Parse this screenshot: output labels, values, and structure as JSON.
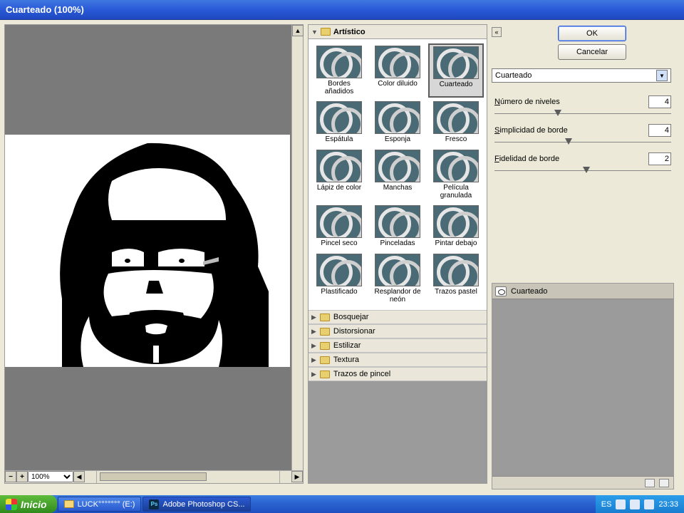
{
  "window": {
    "title": "Cuarteado (100%)"
  },
  "preview": {
    "zoom": "100%"
  },
  "gallery": {
    "open_category": "Artístico",
    "filters": [
      {
        "label": "Bordes añadidos"
      },
      {
        "label": "Color diluido"
      },
      {
        "label": "Cuarteado",
        "selected": true
      },
      {
        "label": "Espátula"
      },
      {
        "label": "Esponja"
      },
      {
        "label": "Fresco"
      },
      {
        "label": "Lápiz de color"
      },
      {
        "label": "Manchas"
      },
      {
        "label": "Película granulada"
      },
      {
        "label": "Pincel seco"
      },
      {
        "label": "Pinceladas"
      },
      {
        "label": "Pintar debajo"
      },
      {
        "label": "Plastificado"
      },
      {
        "label": "Resplandor de neón"
      },
      {
        "label": "Trazos pastel"
      }
    ],
    "collapsed_categories": [
      "Bosquejar",
      "Distorsionar",
      "Estilizar",
      "Textura",
      "Trazos de pincel"
    ]
  },
  "controls": {
    "ok": "OK",
    "cancel": "Cancelar",
    "selected_filter": "Cuarteado",
    "params": [
      {
        "label": "Número de niveles",
        "value": "4",
        "pos": 34
      },
      {
        "label": "Simplicidad de borde",
        "value": "4",
        "pos": 40
      },
      {
        "label": "Fidelidad de borde",
        "value": "2",
        "pos": 50
      }
    ]
  },
  "layers": {
    "active_layer": "Cuarteado"
  },
  "taskbar": {
    "start": "Inicio",
    "items": [
      {
        "label": "LUCK°°°°°°° (E:)",
        "icon": "folder"
      },
      {
        "label": "Adobe Photoshop CS...",
        "icon": "ps",
        "active": true
      }
    ],
    "tray": {
      "lang": "ES",
      "time": "23:33"
    }
  }
}
